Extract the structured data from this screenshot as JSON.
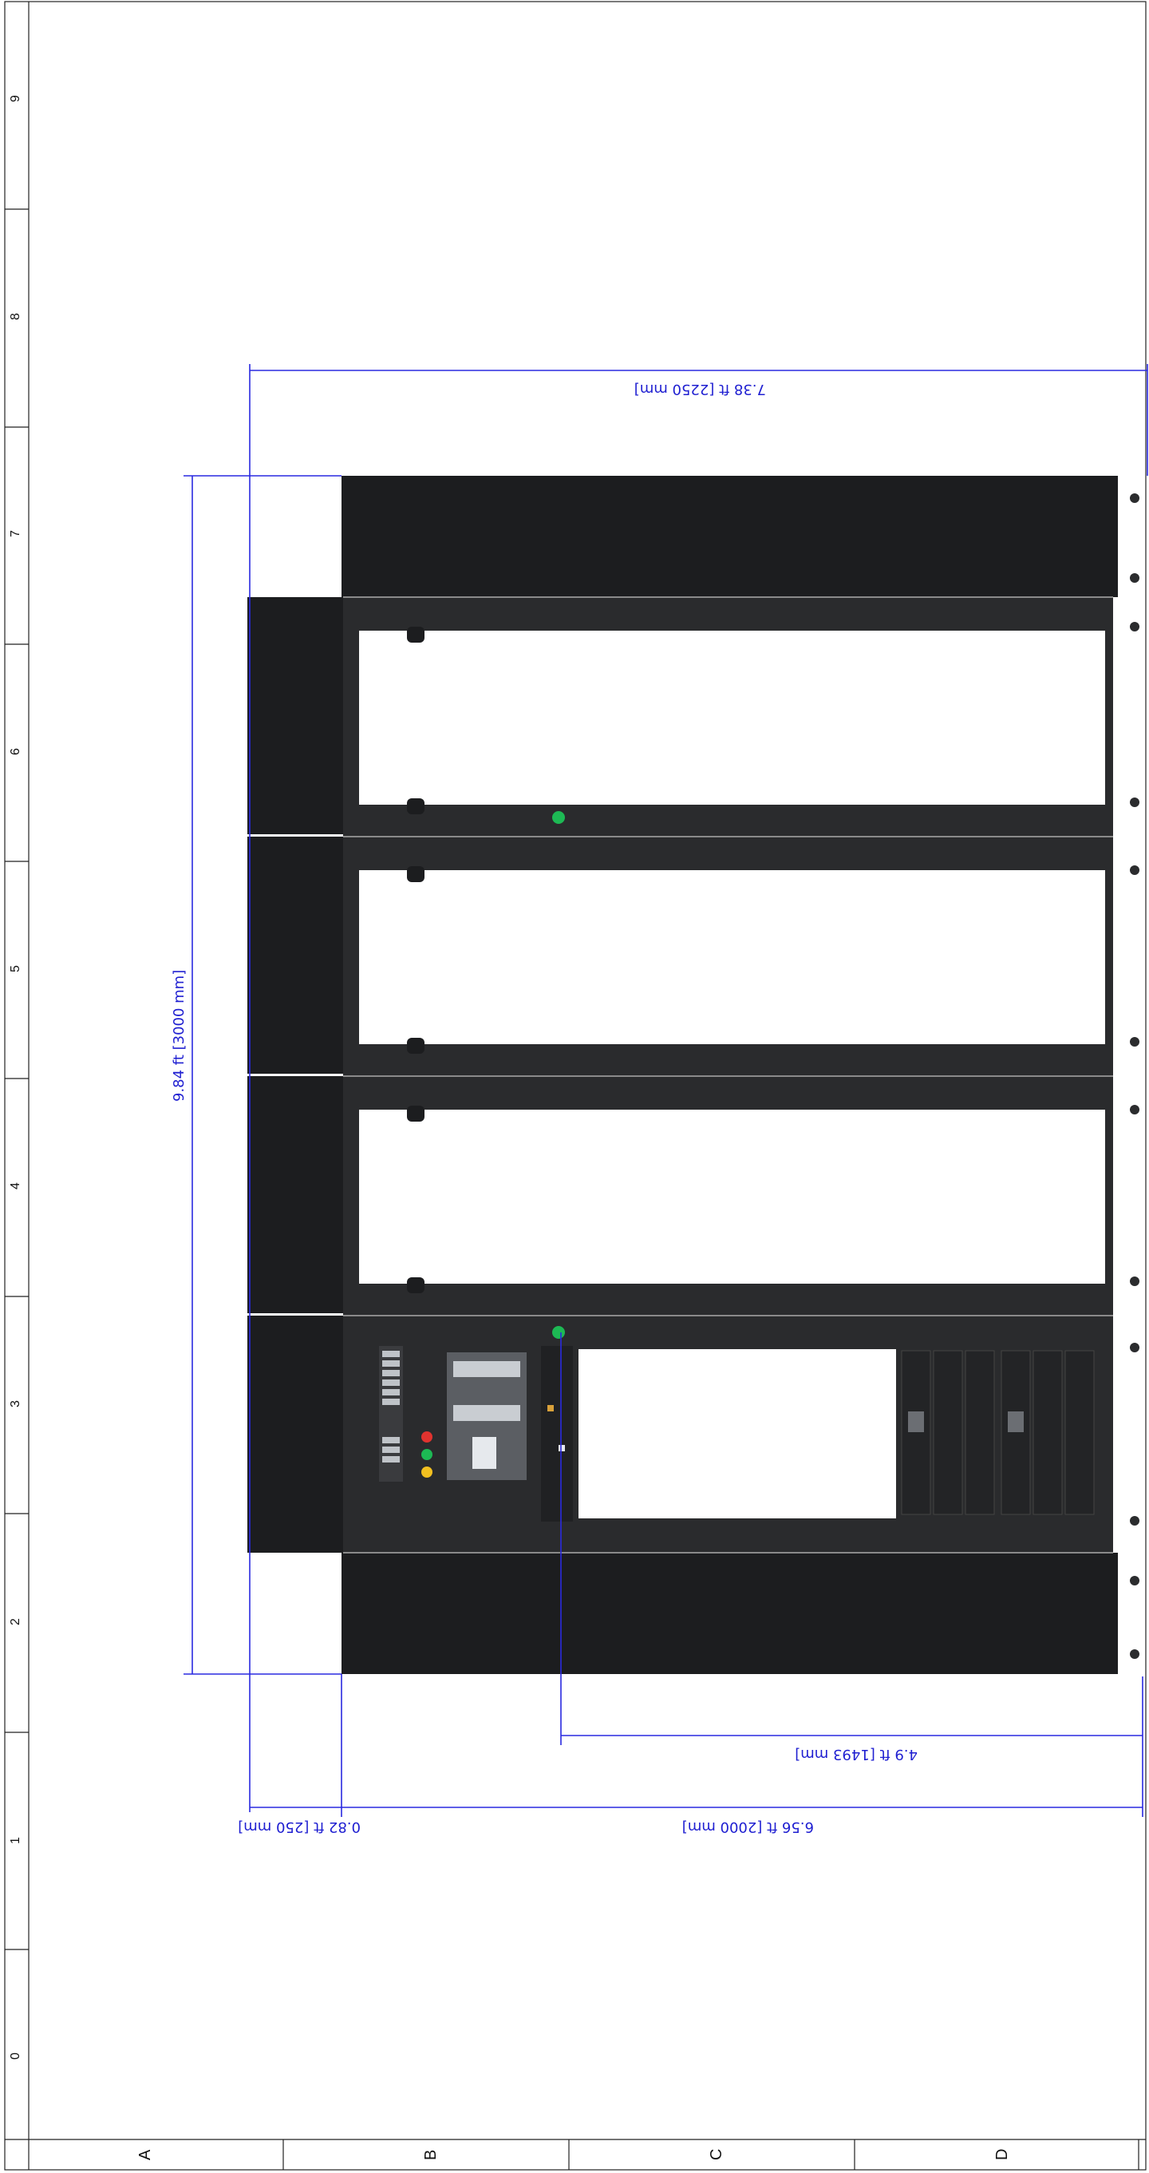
{
  "drawing": {
    "row_zones": [
      "A",
      "B",
      "C",
      "D"
    ],
    "col_zones": [
      "0",
      "1",
      "2",
      "3",
      "4",
      "5",
      "6",
      "7",
      "8",
      "9"
    ],
    "dimensions": {
      "total_height": "9.84 ft [3000 mm]",
      "total_width": "7.38 ft [2250 mm]",
      "cabinet_width": "6.56 ft [2000 mm]",
      "offset_depth": "0.82 ft [250 mm]",
      "partial_width": "4.9 ft [1493 mm]"
    },
    "colors": {
      "dimension": "#1f1fd1",
      "rack": "#1c1d1f",
      "indicator_green": "#1db954",
      "indicator_red": "#e0332f",
      "indicator_yellow": "#f2c020"
    }
  }
}
